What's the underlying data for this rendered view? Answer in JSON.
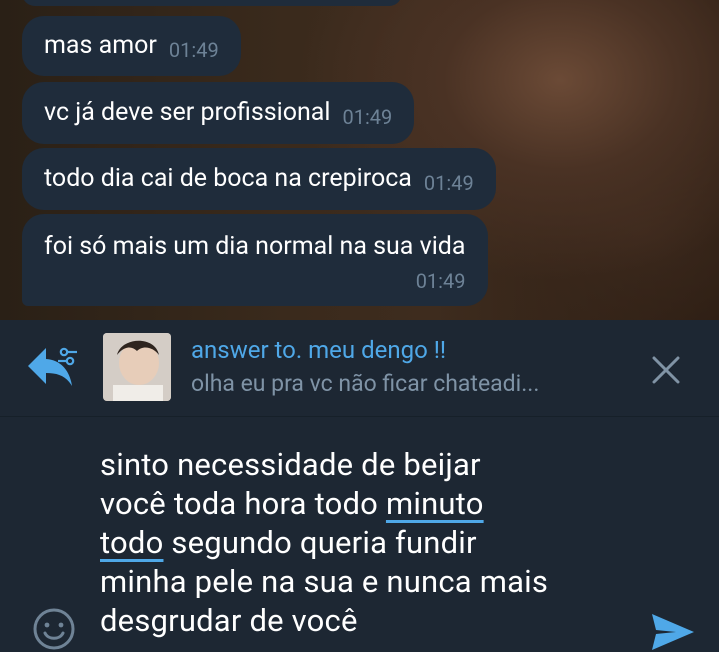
{
  "messages": [
    {
      "text": "mas amor",
      "time": "01:49"
    },
    {
      "text": "vc já deve ser profissional",
      "time": "01:49"
    },
    {
      "text": "todo dia cai de boca na crepiroca",
      "time": "01:49"
    },
    {
      "text": "foi só mais um dia normal na sua vida",
      "time": "01:49"
    }
  ],
  "reply": {
    "title": "answer to. meu dengo !!",
    "preview": "olha eu pra vc não ficar chateadi..."
  },
  "composer": {
    "line1": "sinto necessidade de beijar",
    "line2_a": "você toda hora todo ",
    "line2_b": "minuto",
    "line3_a": "todo",
    "line3_b": " segundo queria fundir",
    "line4": "minha pele na sua e nunca mais",
    "line5": "desgrudar de você"
  },
  "colors": {
    "accent": "#4fa8e8",
    "bubble": "#1f2c3b",
    "panel": "#1d2733",
    "time": "#6d8296"
  },
  "icons": [
    "reply-arrow-icon",
    "close-icon",
    "emoji-icon",
    "send-icon"
  ]
}
